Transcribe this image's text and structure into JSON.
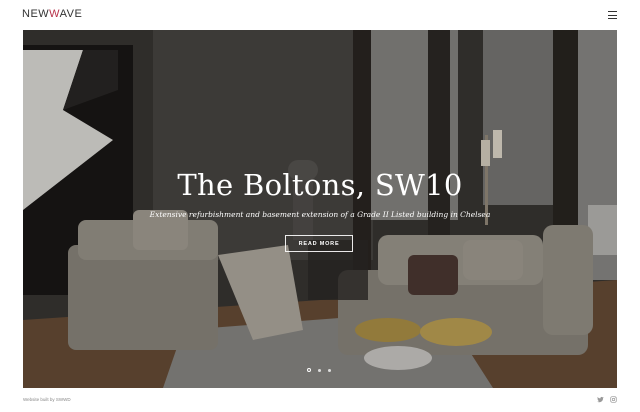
{
  "header": {
    "logo_part1": "NEW",
    "logo_w": "W",
    "logo_part2": "AVE",
    "menu_icon": "hamburger-menu-icon"
  },
  "hero": {
    "title": "The Boltons, SW10",
    "subtitle": "Extensive refurbishment and basement extension of a Grade II Listed building in Chelsea",
    "cta_label": "READ MORE",
    "slides": {
      "count": 3,
      "active_index": 0
    }
  },
  "footer": {
    "credit": "Website built by SWWD",
    "social": [
      "twitter-icon",
      "instagram-icon"
    ]
  },
  "colors": {
    "accent": "#b8324a",
    "text_dark": "#333333",
    "footer_text": "#888888"
  }
}
